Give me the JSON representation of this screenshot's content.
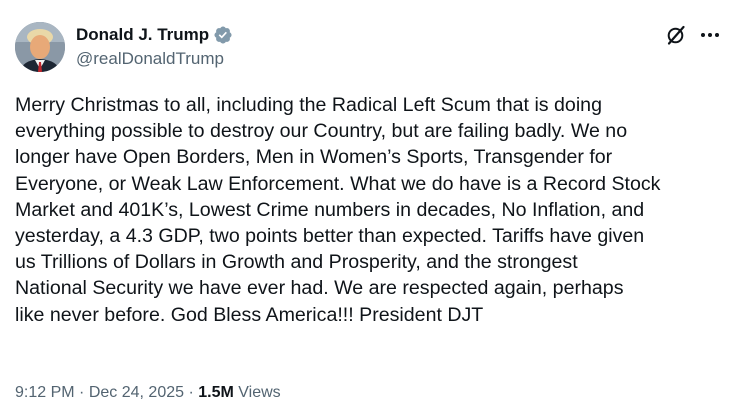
{
  "author": {
    "display_name": "Donald J. Trump",
    "handle": "@realDonaldTrump",
    "verified": true,
    "verified_color": "#829aab"
  },
  "actions": {
    "grok_icon": "grok-icon",
    "more_icon": "more-options-icon"
  },
  "post": {
    "text": "Merry Christmas to all, including the Radical Left Scum that is doing\neverything possible to destroy our Country, but are failing badly. We no\nlonger have Open Borders, Men in Women’s Sports, Transgender for\nEveryone, or Weak Law Enforcement. What we do have is a Record Stock\nMarket and 401K’s, Lowest Crime numbers in decades, No Inflation, and\nyesterday, a 4.3 GDP, two points better than expected. Tariffs have given\nus Trillions of Dollars in Growth and Prosperity, and the strongest\nNational Security we have ever had. We are respected again, perhaps\nlike never before. God Bless America!!! President DJT"
  },
  "meta": {
    "time": "9:12 PM",
    "separator": "·",
    "date": "Dec 24, 2025",
    "views_count": "1.5M",
    "views_label": "Views"
  },
  "colors": {
    "text_primary": "#0f1419",
    "text_secondary": "#536471",
    "background": "#ffffff"
  }
}
